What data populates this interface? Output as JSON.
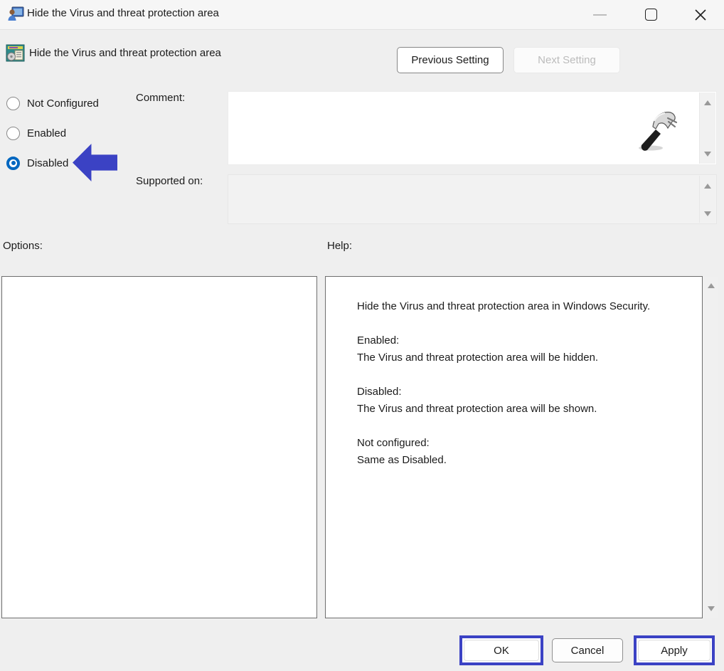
{
  "window": {
    "title": "Hide the Virus and threat protection area"
  },
  "header": {
    "title": "Hide the Virus and threat protection area",
    "previous_label": "Previous Setting",
    "next_label": "Next Setting",
    "next_enabled": false
  },
  "config": {
    "radio_options": [
      {
        "label": "Not Configured",
        "selected": false
      },
      {
        "label": "Enabled",
        "selected": false
      },
      {
        "label": "Disabled",
        "selected": true
      }
    ],
    "comment_label": "Comment:",
    "comment_value": "",
    "supported_on_label": "Supported on:",
    "supported_on_value": ""
  },
  "options_panel": {
    "label": "Options:"
  },
  "help_panel": {
    "label": "Help:",
    "description": "Hide the Virus and threat protection area in Windows Security.",
    "sections": [
      {
        "heading": "Enabled:",
        "body": "The Virus and threat protection area will be hidden."
      },
      {
        "heading": "Disabled:",
        "body": "The Virus and threat protection area will be shown."
      },
      {
        "heading": "Not configured:",
        "body": "Same as Disabled."
      }
    ]
  },
  "footer": {
    "ok_label": "OK",
    "cancel_label": "Cancel",
    "apply_label": "Apply"
  },
  "icons": {
    "app_icon": "group-policy-user-monitor",
    "header_icon": "policy-setting-document",
    "minimize_icon": "minimize-dash",
    "maximize_icon": "maximize-square",
    "close_icon": "close-x",
    "scroll_up_icon": "triangle-up",
    "scroll_down_icon": "triangle-down",
    "hammer_cursor": "hammer",
    "annotation_arrow": "left-arrow"
  },
  "colors": {
    "annotation_blue": "#3b42c4",
    "radio_accent": "#0067c0",
    "dialog_background": "#efefef"
  }
}
